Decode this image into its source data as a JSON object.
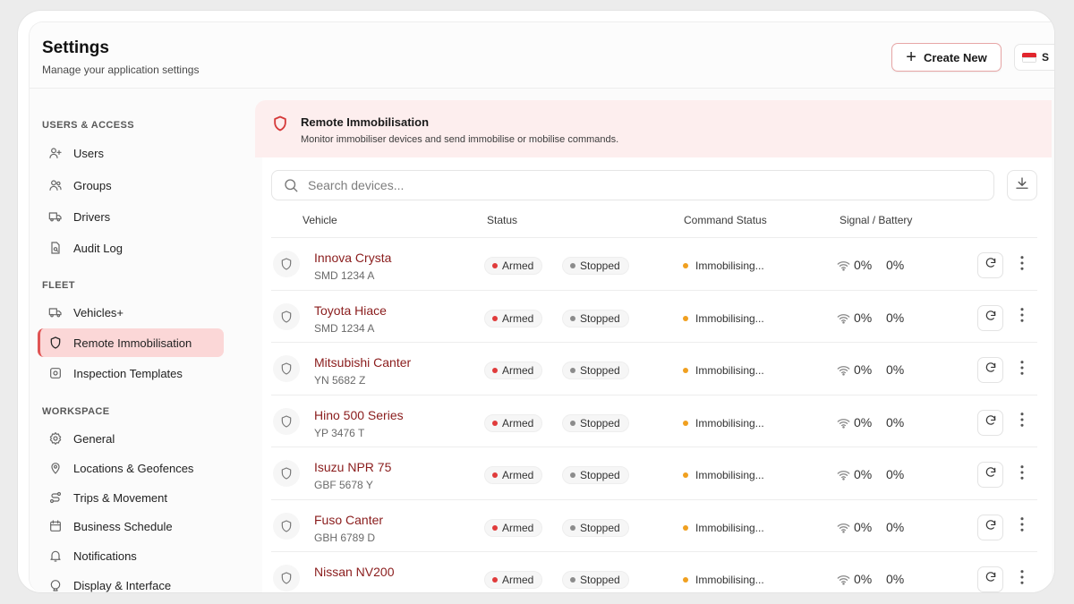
{
  "header": {
    "title": "Settings",
    "subtitle": "Manage your application settings",
    "create_label": "Create New",
    "lang_label": "S"
  },
  "sidebar": {
    "sections": [
      {
        "label": "USERS & ACCESS",
        "items": [
          {
            "label": "Users",
            "icon": "user-plus-icon"
          },
          {
            "label": "Groups",
            "icon": "users-icon"
          },
          {
            "label": "Drivers",
            "icon": "truck-icon"
          },
          {
            "label": "Audit Log",
            "icon": "file-search-icon"
          }
        ]
      },
      {
        "label": "FLEET",
        "items": [
          {
            "label": "Vehicles+",
            "icon": "truck-icon"
          },
          {
            "label": "Remote Immobilisation",
            "icon": "shield-icon",
            "active": true
          },
          {
            "label": "Inspection Templates",
            "icon": "camera-icon"
          }
        ]
      },
      {
        "label": "WORKSPACE",
        "items": [
          {
            "label": "General",
            "icon": "gear-icon"
          },
          {
            "label": "Locations & Geofences",
            "icon": "map-pin-icon"
          },
          {
            "label": "Trips & Movement",
            "icon": "route-icon"
          },
          {
            "label": "Business Schedule",
            "icon": "calendar-icon"
          },
          {
            "label": "Notifications",
            "icon": "bell-icon"
          },
          {
            "label": "Display & Interface",
            "icon": "monitor-icon"
          }
        ]
      }
    ]
  },
  "banner": {
    "title": "Remote Immobilisation",
    "description": "Monitor immobiliser devices and send immobilise or mobilise commands."
  },
  "search": {
    "placeholder": "Search devices..."
  },
  "table": {
    "columns": [
      "Vehicle",
      "Status",
      "Command Status",
      "Signal / Battery"
    ],
    "rows": [
      {
        "name": "Innova Crysta",
        "plate": "SMD 1234 A",
        "status": "Armed",
        "motion": "Stopped",
        "command": "Immobilising...",
        "signal": "0%",
        "battery": "0%"
      },
      {
        "name": "Toyota Hiace",
        "plate": "SMD 1234 A",
        "status": "Armed",
        "motion": "Stopped",
        "command": "Immobilising...",
        "signal": "0%",
        "battery": "0%"
      },
      {
        "name": "Mitsubishi Canter",
        "plate": "YN 5682 Z",
        "status": "Armed",
        "motion": "Stopped",
        "command": "Immobilising...",
        "signal": "0%",
        "battery": "0%"
      },
      {
        "name": "Hino 500 Series",
        "plate": "YP 3476 T",
        "status": "Armed",
        "motion": "Stopped",
        "command": "Immobilising...",
        "signal": "0%",
        "battery": "0%"
      },
      {
        "name": "Isuzu NPR 75",
        "plate": "GBF 5678 Y",
        "status": "Armed",
        "motion": "Stopped",
        "command": "Immobilising...",
        "signal": "0%",
        "battery": "0%"
      },
      {
        "name": "Fuso Canter",
        "plate": "GBH 6789 D",
        "status": "Armed",
        "motion": "Stopped",
        "command": "Immobilising...",
        "signal": "0%",
        "battery": "0%"
      },
      {
        "name": "Nissan NV200",
        "plate": "",
        "status": "Armed",
        "motion": "Stopped",
        "command": "Immobilising...",
        "signal": "0%",
        "battery": "0%"
      }
    ]
  },
  "colors": {
    "accent": "#e05454",
    "armed_dot": "#e03b3b",
    "stopped_dot": "#8c8c8c",
    "pending_dot": "#f0a020",
    "vehicle_name": "#8a1c1c"
  }
}
